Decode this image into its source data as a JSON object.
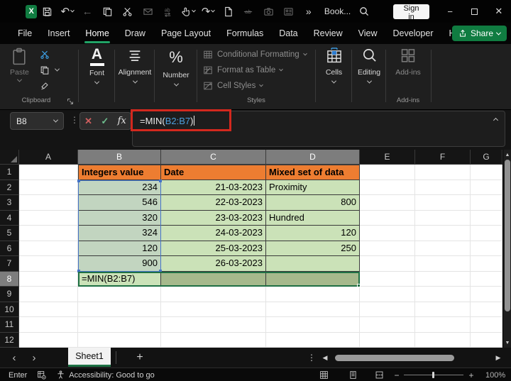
{
  "titlebar": {
    "document_title": "Book...",
    "sign_in_label": "Sign in",
    "overflow_glyph": "»"
  },
  "ribbon": {
    "tabs": [
      {
        "label": "File",
        "active": false
      },
      {
        "label": "Insert",
        "active": false
      },
      {
        "label": "Home",
        "active": true
      },
      {
        "label": "Draw",
        "active": false
      },
      {
        "label": "Page Layout",
        "active": false
      },
      {
        "label": "Formulas",
        "active": false
      },
      {
        "label": "Data",
        "active": false
      },
      {
        "label": "Review",
        "active": false
      },
      {
        "label": "View",
        "active": false
      },
      {
        "label": "Developer",
        "active": false
      },
      {
        "label": "Help",
        "active": false
      }
    ],
    "share_label": "Share",
    "clipboard": {
      "group_label": "Clipboard",
      "paste_label": "Paste"
    },
    "font": {
      "group_label": "Font"
    },
    "alignment": {
      "group_label": "Alignment"
    },
    "number": {
      "group_label": "Number"
    },
    "styles": {
      "group_label": "Styles",
      "items": [
        "Conditional Formatting",
        "Format as Table",
        "Cell Styles"
      ]
    },
    "cells": {
      "group_label": "Cells"
    },
    "editing": {
      "group_label": "Editing"
    },
    "addins": {
      "group_label": "Add-ins",
      "button_label": "Add-ins"
    }
  },
  "formula_bar": {
    "name_box_value": "B8",
    "formula_prefix": "=MIN(",
    "formula_range": "B2:B7",
    "formula_suffix": ")"
  },
  "grid": {
    "column_headers": [
      "A",
      "B",
      "C",
      "D",
      "E",
      "F",
      "G"
    ],
    "row_headers": [
      "1",
      "2",
      "3",
      "4",
      "5",
      "6",
      "7",
      "8",
      "9",
      "10",
      "11",
      "12"
    ],
    "selected_columns": [
      "B",
      "C",
      "D"
    ],
    "selected_row": "8",
    "table_header_cells": [
      {
        "ref": "B1",
        "text": "Integers value"
      },
      {
        "ref": "C1",
        "text": "Date"
      },
      {
        "ref": "D1",
        "text": "Mixed set of data"
      }
    ],
    "data_cells": [
      {
        "ref": "B2",
        "text": "234",
        "align": "right"
      },
      {
        "ref": "C2",
        "text": "21-03-2023",
        "align": "right"
      },
      {
        "ref": "D2",
        "text": "Proximity",
        "align": "left"
      },
      {
        "ref": "B3",
        "text": "546",
        "align": "right"
      },
      {
        "ref": "C3",
        "text": "22-03-2023",
        "align": "right"
      },
      {
        "ref": "D3",
        "text": "800",
        "align": "right"
      },
      {
        "ref": "B4",
        "text": "320",
        "align": "right"
      },
      {
        "ref": "C4",
        "text": "23-03-2023",
        "align": "right"
      },
      {
        "ref": "D4",
        "text": "Hundred",
        "align": "left"
      },
      {
        "ref": "B5",
        "text": "324",
        "align": "right"
      },
      {
        "ref": "C5",
        "text": "24-03-2023",
        "align": "right"
      },
      {
        "ref": "D5",
        "text": "120",
        "align": "right"
      },
      {
        "ref": "B6",
        "text": "120",
        "align": "right"
      },
      {
        "ref": "C6",
        "text": "25-03-2023",
        "align": "right"
      },
      {
        "ref": "D6",
        "text": "250",
        "align": "right"
      },
      {
        "ref": "B7",
        "text": "900",
        "align": "right"
      },
      {
        "ref": "C7",
        "text": "26-03-2023",
        "align": "right"
      },
      {
        "ref": "B8",
        "text": "=MIN(B2:B7)",
        "align": "left"
      }
    ],
    "empty_table_cells": [
      "D7"
    ],
    "selected_fill_cells": [
      "C8",
      "D8"
    ],
    "edit_range": "B2:B7",
    "selection_range": "B8:D8"
  },
  "sheet_bar": {
    "sheet_tab_label": "Sheet1"
  },
  "status_bar": {
    "mode": "Enter",
    "accessibility_status": "Accessibility: Good to go",
    "zoom_level": "100%"
  },
  "colors": {
    "accent_green": "#107C41",
    "header_orange": "#ED7D31",
    "cell_green": "#CBE2B8",
    "cell_green_muted": "#C2D5C0",
    "cell_green_selected": "#A6B98C",
    "range_blue": "#4472C4",
    "annotation_red": "#D3281E",
    "formula_ref_blue": "#4D9FDD"
  }
}
